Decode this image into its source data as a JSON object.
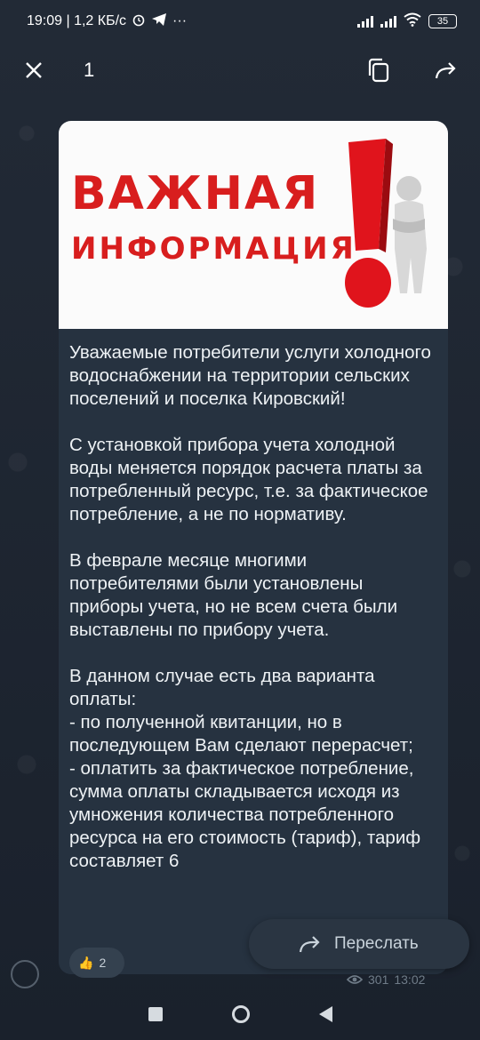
{
  "status_bar": {
    "time_speed": "19:09 | 1,2 КБ/с",
    "more": "···",
    "battery": "35"
  },
  "viewer": {
    "counter": "1"
  },
  "post": {
    "poster": {
      "line1": "ВАЖНАЯ",
      "line2": "ИНФОРМАЦИЯ"
    },
    "paragraphs": [
      "Уважаемые потребители услуги холодного водоснабжении на территории сельских поселений и поселка Кировский!",
      "С установкой прибора учета холодной воды меняется порядок расчета платы за потребленный ресурс, т.е. за фактическое потребление, а не по нормативу.",
      "В феврале месяце многими потребителями были установлены приборы учета, но не всем счета были выставлены по прибору учета.",
      "В данном случае есть два варианта оплаты:\n- по полученной квитанции, но в последующем Вам сделают перерасчет;\n- оплатить за фактическое потребление, сумма оплаты складывается исходя из умножения количества потребленного ресурса на его стоимость (тариф), тариф составляет 6"
    ],
    "reaction": {
      "emoji": "👍",
      "count": "2"
    },
    "views": "301",
    "time": "13:02"
  },
  "forward": {
    "label": "Переслать"
  },
  "colors": {
    "accent_red": "#d81e1e",
    "bubble": "#263240",
    "background": "#1d2430"
  }
}
